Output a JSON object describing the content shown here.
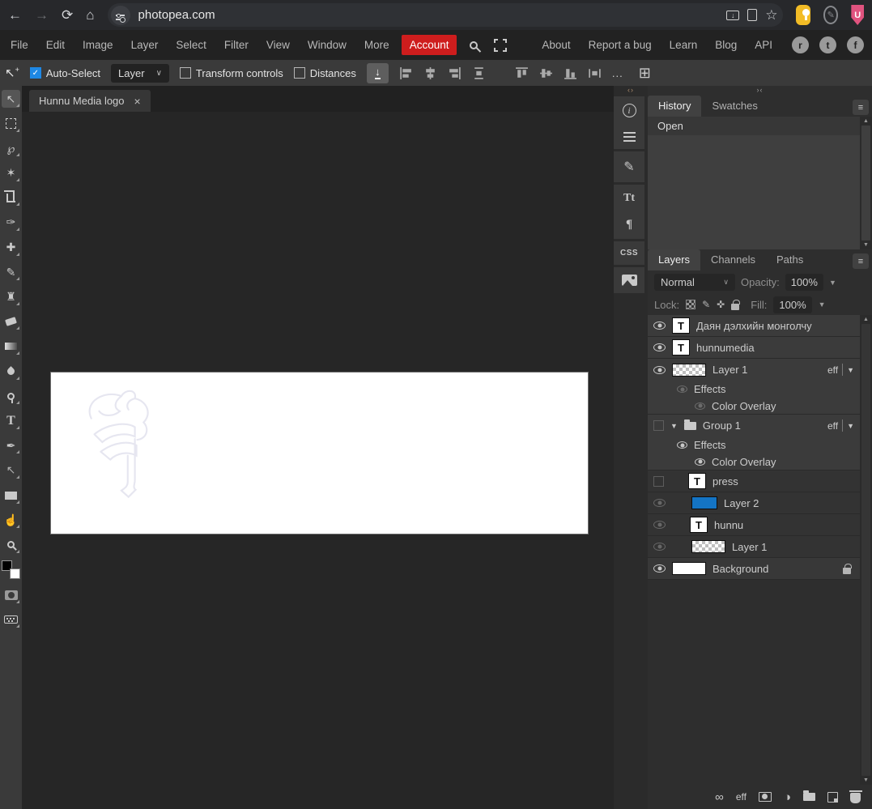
{
  "browser": {
    "url": "photopea.com"
  },
  "menubar": {
    "items": [
      "File",
      "Edit",
      "Image",
      "Layer",
      "Select",
      "Filter",
      "View",
      "Window",
      "More"
    ],
    "account": "Account",
    "links": [
      "About",
      "Report a bug",
      "Learn",
      "Blog",
      "API"
    ]
  },
  "options": {
    "auto_select": "Auto-Select",
    "layer_mode": "Layer",
    "transform_controls": "Transform controls",
    "distances": "Distances",
    "ellipsis": "..."
  },
  "tab": {
    "title": "Hunnu Media logo",
    "close": "×"
  },
  "strip": {
    "character": "Tt",
    "paragraph": "¶",
    "css": "CSS"
  },
  "history": {
    "tabs": [
      "History",
      "Swatches"
    ],
    "entries": [
      "Open"
    ]
  },
  "layers": {
    "tabs": [
      "Layers",
      "Channels",
      "Paths"
    ],
    "blend_mode": "Normal",
    "opacity_label": "Opacity:",
    "opacity_value": "100%",
    "lock_label": "Lock:",
    "fill_label": "Fill:",
    "fill_value": "100%",
    "eff": "eff",
    "text_thumb_glyph": "T",
    "rows": [
      {
        "name": "Даян дэлхийн монголчу",
        "type": "text",
        "visible": true
      },
      {
        "name": "hunnumedia",
        "type": "text",
        "visible": true
      },
      {
        "name": "Layer 1",
        "type": "pixel-transparent",
        "visible": true,
        "has_effects": true
      },
      {
        "name": "Effects",
        "type": "effects-sub",
        "visible": false
      },
      {
        "name": "Color Overlay",
        "type": "effect-item",
        "visible": false
      },
      {
        "name": "Group 1",
        "type": "group",
        "visible": false,
        "has_effects": true,
        "expanded": true
      },
      {
        "name": "Effects",
        "type": "effects-sub",
        "visible": true
      },
      {
        "name": "Color Overlay",
        "type": "effect-item",
        "visible": true
      },
      {
        "name": "press",
        "type": "text",
        "visible": false
      },
      {
        "name": "Layer 2",
        "type": "pixel-blue",
        "visible": "dim"
      },
      {
        "name": "hunnu",
        "type": "text",
        "visible": "dim"
      },
      {
        "name": "Layer 1",
        "type": "pixel-transparent",
        "visible": "dim"
      },
      {
        "name": "Background",
        "type": "pixel-white",
        "visible": true,
        "locked": true
      }
    ]
  },
  "icons": {
    "reddit_glyph": "r",
    "twitter_glyph": "t",
    "facebook_glyph": "f",
    "menu_glyph": "≡",
    "chevron_down": "∨",
    "tri_down": "▼",
    "tri_up": "▲",
    "collapse_lr": "‹›",
    "collapse_rl": "›‹",
    "grid": "⊞",
    "adjust_half": "◑",
    "link": "∞"
  },
  "colors": {
    "account_red": "#ce1d1d",
    "checkbox_blue": "#1e88e5",
    "layer2_blue": "#1474c4",
    "extension_yellow": "#f2bc26",
    "extension_pink": "#e0537f",
    "canvas_white": "#ffffff",
    "logo_stroke": "#e6e6f0"
  }
}
